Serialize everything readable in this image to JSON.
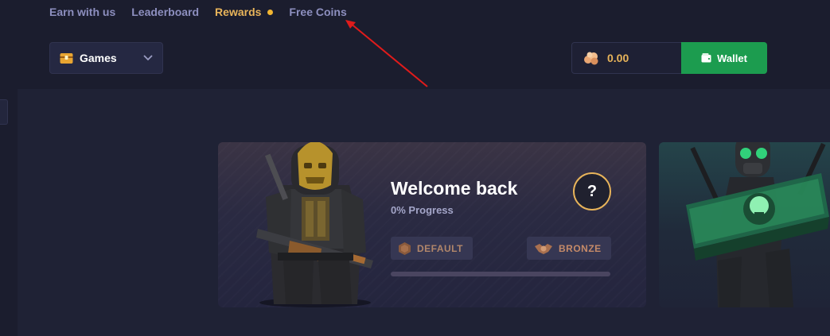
{
  "nav": {
    "items": [
      {
        "label": "Earn with us"
      },
      {
        "label": "Leaderboard"
      },
      {
        "label": "Rewards",
        "active": true
      },
      {
        "label": "Free Coins"
      }
    ]
  },
  "games_select": {
    "label": "Games",
    "icon": "chest-icon"
  },
  "balance": {
    "amount": "0.00",
    "icon": "coins-icon"
  },
  "wallet": {
    "label": "Wallet",
    "icon": "wallet-icon"
  },
  "welcome": {
    "title": "Welcome back",
    "progress_text": "0% Progress",
    "progress_value": 0,
    "help_label": "?",
    "current_rank": "DEFAULT",
    "next_rank": "BRONZE"
  },
  "colors": {
    "accent": "#e8b45a",
    "wallet_green": "#1c9c4f",
    "nav_text": "#8d8fbf",
    "background": "#1b1d2e"
  }
}
